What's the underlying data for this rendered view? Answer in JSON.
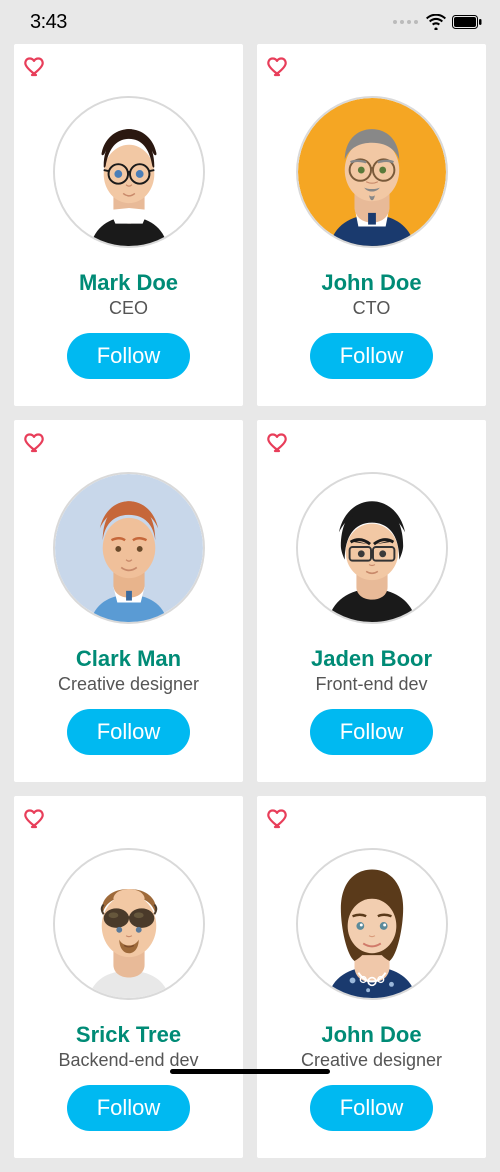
{
  "status": {
    "time": "3:43"
  },
  "follow_label": "Follow",
  "people": [
    {
      "name": "Mark Doe",
      "role": "CEO"
    },
    {
      "name": "John Doe",
      "role": "CTO"
    },
    {
      "name": "Clark Man",
      "role": "Creative designer"
    },
    {
      "name": "Jaden Boor",
      "role": "Front-end dev"
    },
    {
      "name": "Srick Tree",
      "role": "Backend-end dev"
    },
    {
      "name": "John Doe",
      "role": "Creative designer"
    }
  ]
}
